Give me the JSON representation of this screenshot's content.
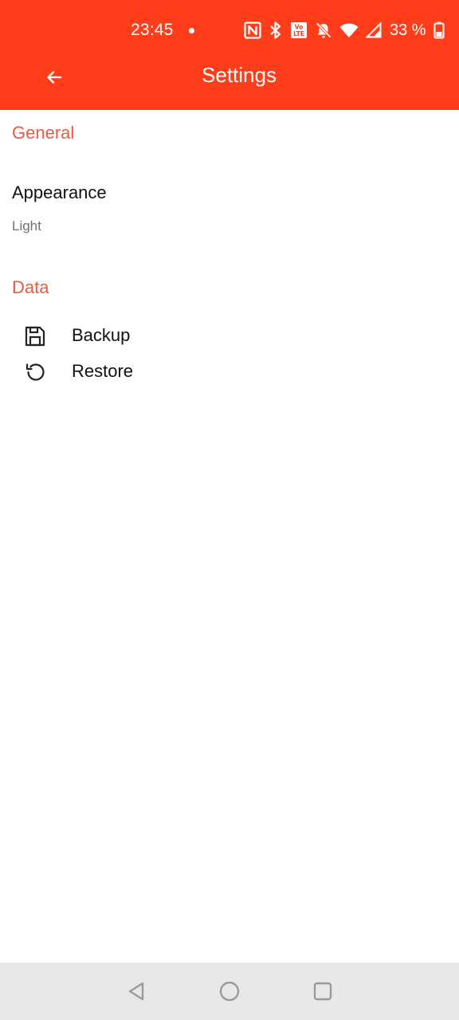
{
  "status_bar": {
    "time": "23:45",
    "battery": "33 %",
    "icons": [
      "notification-dot-icon",
      "nfc-icon",
      "bluetooth-icon",
      "volte-icon",
      "bell-off-icon",
      "wifi-icon",
      "signal-icon",
      "battery-icon"
    ]
  },
  "app_bar": {
    "title": "Settings",
    "back_icon": "arrow-left-icon"
  },
  "sections": {
    "general": {
      "header": "General",
      "appearance": {
        "title": "Appearance",
        "summary": "Light"
      }
    },
    "data": {
      "header": "Data",
      "items": [
        {
          "label": "Backup",
          "icon": "floppy-disk-icon"
        },
        {
          "label": "Restore",
          "icon": "restore-icon"
        }
      ]
    }
  },
  "nav_bar": {
    "icons": [
      "back-triangle-icon",
      "home-circle-icon",
      "recents-square-icon"
    ]
  },
  "colors": {
    "accent": "#FF3D1A",
    "section_header": "#E65B3F",
    "nav_bar": "#E8E8E8"
  }
}
